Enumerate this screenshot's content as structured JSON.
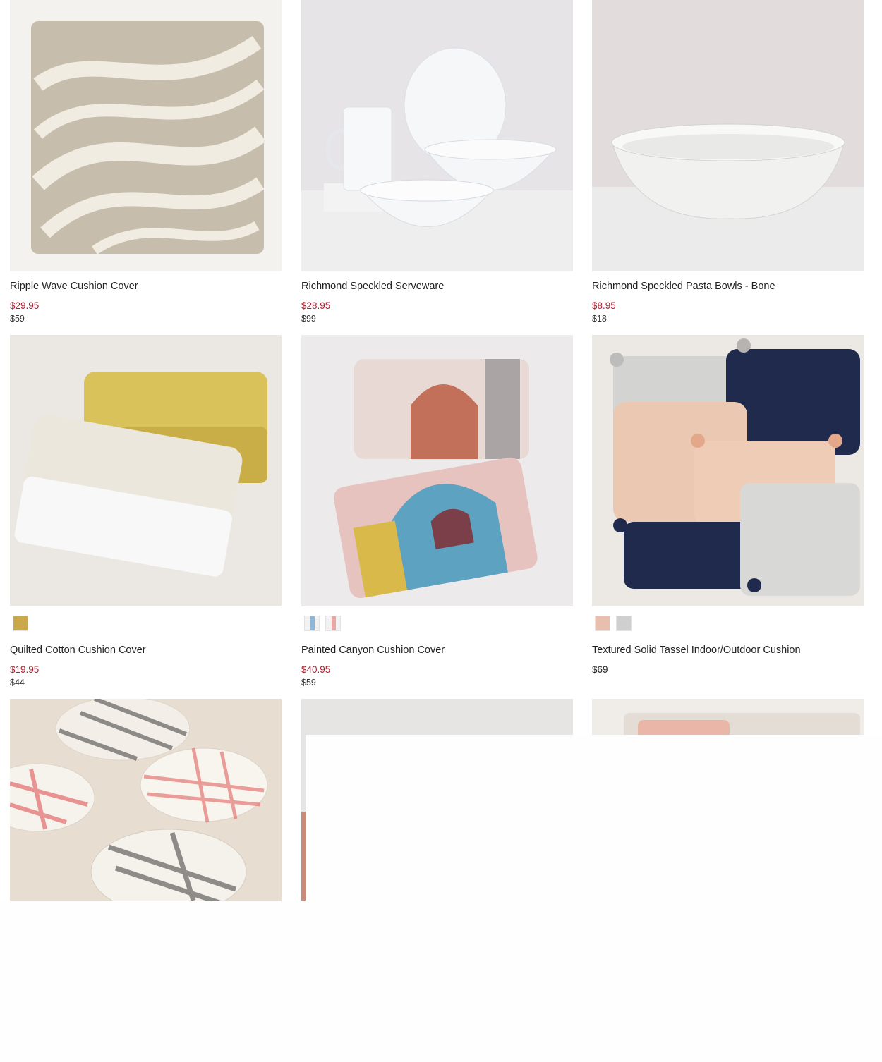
{
  "products": [
    {
      "name": "Ripple Wave Cushion Cover",
      "sale_price": "$29.95",
      "original_price": "$59",
      "image_icon": "wave-pattern-cushion-image"
    },
    {
      "name": "Richmond Speckled Serveware",
      "sale_price": "$28.95",
      "original_price": "$99",
      "image_icon": "white-serveware-image"
    },
    {
      "name": "Richmond Speckled Pasta Bowls - Bone",
      "sale_price": "$8.95",
      "original_price": "$18",
      "image_icon": "pasta-bowl-image"
    },
    {
      "name": "Quilted Cotton Cushion Cover",
      "sale_price": "$19.95",
      "original_price": "$44",
      "image_icon": "quilted-cushions-image",
      "swatches": [
        "#c9a94a"
      ]
    },
    {
      "name": "Painted Canyon Cushion Cover",
      "sale_price": "$40.95",
      "original_price": "$59",
      "image_icon": "painted-canyon-cushions-image",
      "swatches": [
        "#8fb6d4",
        "#e7a8a5"
      ]
    },
    {
      "name": "Textured Solid Tassel Indoor/Outdoor Cushion",
      "price": "$69",
      "image_icon": "tassel-cushions-image",
      "swatches": [
        "#e8bfae",
        "#cfcfcf"
      ]
    },
    {
      "image_icon": "plaid-plates-image"
    },
    {
      "image_icon": "partial-product-image"
    },
    {
      "image_icon": "partial-pink-cushion-image"
    }
  ],
  "colors": {
    "sale": "#b01f2e",
    "text": "#222222",
    "background": "#ffffff"
  }
}
